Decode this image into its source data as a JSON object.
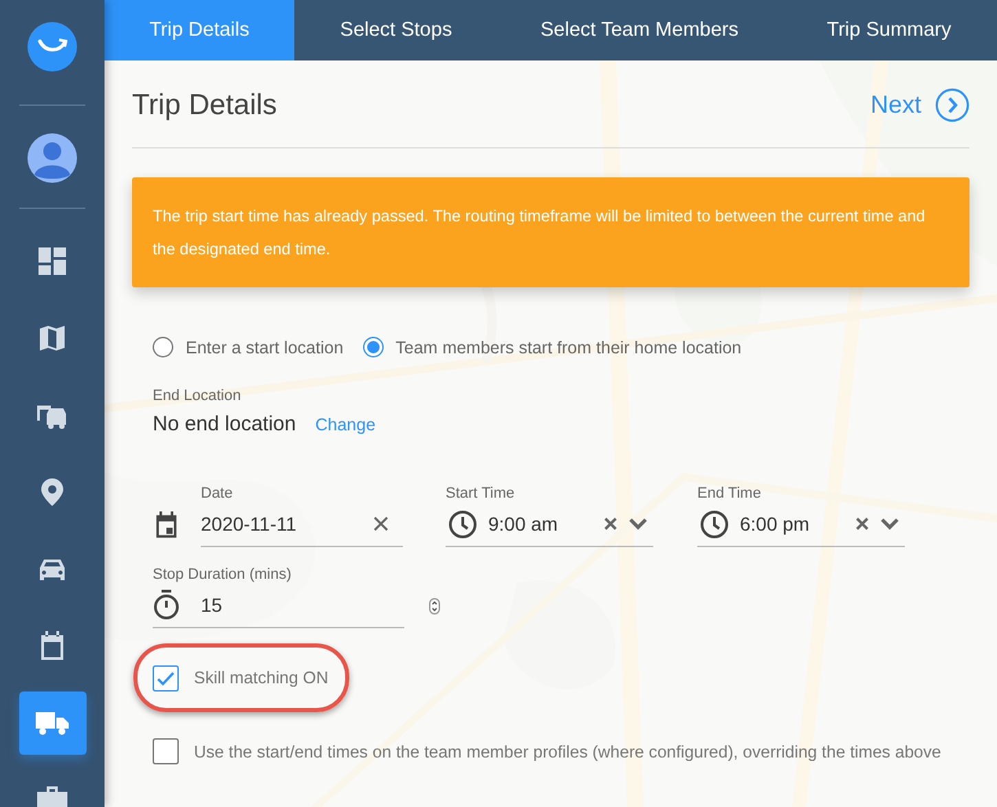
{
  "sidebar": {
    "items": [
      {
        "kind": "dashboard",
        "selected": false
      },
      {
        "kind": "map",
        "selected": false
      },
      {
        "kind": "vehicles",
        "selected": false
      },
      {
        "kind": "pin",
        "selected": false
      },
      {
        "kind": "car",
        "selected": false
      },
      {
        "kind": "calendar",
        "selected": false
      },
      {
        "kind": "truck",
        "selected": true
      },
      {
        "kind": "briefcase",
        "selected": false
      }
    ]
  },
  "tabs": [
    {
      "label": "Trip Details",
      "selected": true
    },
    {
      "label": "Select Stops",
      "selected": false
    },
    {
      "label": "Select Team Members",
      "selected": false
    },
    {
      "label": "Trip Summary",
      "selected": false
    }
  ],
  "title": "Trip Details",
  "next": "Next",
  "alert": "The trip start time has already passed. The routing timeframe will be limited to between the current time and the designated end time.",
  "start_options": [
    {
      "label": "Enter a start location",
      "selected": false
    },
    {
      "label": "Team members start from their home location",
      "selected": true
    }
  ],
  "end_location": {
    "label": "End Location",
    "value": "No end location",
    "action": "Change"
  },
  "date": {
    "label": "Date",
    "value": "2020-11-11"
  },
  "times": [
    {
      "label": "Start Time",
      "value": "9:00 am"
    },
    {
      "label": "End Time",
      "value": "6:00 pm"
    }
  ],
  "stop_duration": {
    "label": "Stop Duration (mins)",
    "value": "15"
  },
  "checkboxes": [
    {
      "label": "Skill matching ON",
      "checked": true,
      "highlighted": true
    },
    {
      "label": "Use the start/end times on the team member profiles (where configured), overriding the times above",
      "checked": false,
      "highlighted": false
    }
  ]
}
